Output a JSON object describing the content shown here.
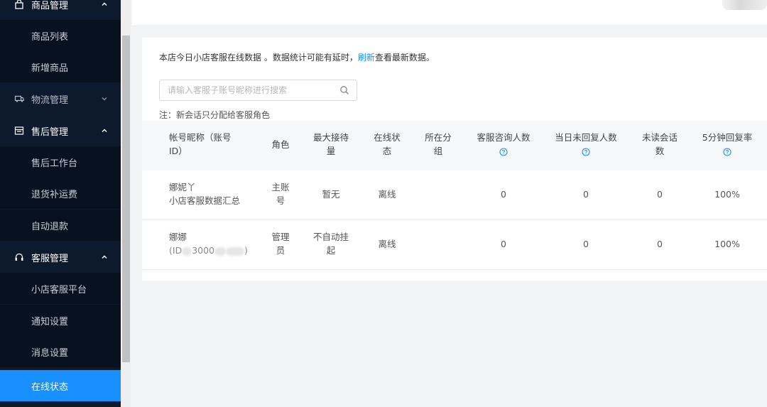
{
  "sidebar": {
    "groups": [
      {
        "label": "商品管理",
        "expanded": true,
        "items": [
          "商品列表",
          "新增商品"
        ]
      },
      {
        "label": "物流管理",
        "expanded": false,
        "items": []
      },
      {
        "label": "售后管理",
        "expanded": true,
        "items": [
          "售后工作台",
          "退货补运费",
          "自动退款"
        ]
      },
      {
        "label": "客服管理",
        "expanded": true,
        "items": [
          "小店客服平台",
          "通知设置",
          "消息设置",
          "在线状态"
        ]
      }
    ],
    "active_item": "在线状态"
  },
  "main": {
    "notice_text": "本店今日小店客服在线数据 。数据统计可能有延时，",
    "notice_link": "刷新",
    "notice_suffix": "查看最新数据。",
    "search_placeholder": "请输入客服子账号昵称进行搜索",
    "note": "注：新会话只分配给客服角色",
    "table": {
      "headers": {
        "account_l1": "帐号昵称（账号",
        "account_l2": "ID）",
        "role": "角色",
        "max_l1": "最大接待",
        "max_l2": "量",
        "online_l1": "在线状",
        "online_l2": "态",
        "group_l1": "所在分",
        "group_l2": "组",
        "consult": "客服咨询人数",
        "unreplied": "当日未回复人数",
        "unread_l1": "未读会话",
        "unread_l2": "数",
        "reply_rate": "5分钟回复率"
      },
      "rows": [
        {
          "name_l1": "娜妮丫",
          "name_l2": "小店客服数据汇总",
          "role_l1": "主账",
          "role_l2": "号",
          "max_l1": "暂无",
          "max_l2": "",
          "status": "离线",
          "group": "",
          "consult": "0",
          "unreplied": "0",
          "unread": "0",
          "rate": "100%"
        },
        {
          "name_l1": "娜娜",
          "name_l2_prefix": "(ID",
          "name_l2_visible": "3000",
          "name_l2_suffix": ")",
          "role_l1": "管理",
          "role_l2": "员",
          "max_l1": "不自动挂",
          "max_l2": "起",
          "status": "离线",
          "group": "",
          "consult": "0",
          "unreplied": "0",
          "unread": "0",
          "rate": "100%"
        }
      ]
    }
  },
  "colors": {
    "sidebar_bg": "#0d1a2d",
    "sidebar_sub_bg": "#07111f",
    "accent": "#1890ff"
  },
  "icons": [
    "shopping-bag-icon",
    "truck-icon",
    "after-sales-icon",
    "headset-icon",
    "search-icon",
    "help-circle-icon"
  ]
}
